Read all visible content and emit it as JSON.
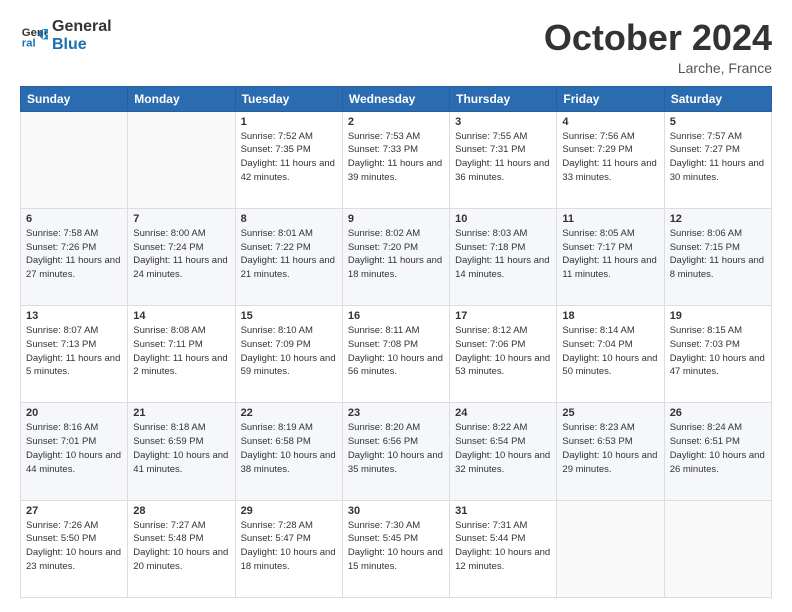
{
  "header": {
    "logo_line1": "General",
    "logo_line2": "Blue",
    "month": "October 2024",
    "location": "Larche, France"
  },
  "days_of_week": [
    "Sunday",
    "Monday",
    "Tuesday",
    "Wednesday",
    "Thursday",
    "Friday",
    "Saturday"
  ],
  "weeks": [
    [
      {
        "day": "",
        "sunrise": "",
        "sunset": "",
        "daylight": ""
      },
      {
        "day": "",
        "sunrise": "",
        "sunset": "",
        "daylight": ""
      },
      {
        "day": "1",
        "sunrise": "Sunrise: 7:52 AM",
        "sunset": "Sunset: 7:35 PM",
        "daylight": "Daylight: 11 hours and 42 minutes."
      },
      {
        "day": "2",
        "sunrise": "Sunrise: 7:53 AM",
        "sunset": "Sunset: 7:33 PM",
        "daylight": "Daylight: 11 hours and 39 minutes."
      },
      {
        "day": "3",
        "sunrise": "Sunrise: 7:55 AM",
        "sunset": "Sunset: 7:31 PM",
        "daylight": "Daylight: 11 hours and 36 minutes."
      },
      {
        "day": "4",
        "sunrise": "Sunrise: 7:56 AM",
        "sunset": "Sunset: 7:29 PM",
        "daylight": "Daylight: 11 hours and 33 minutes."
      },
      {
        "day": "5",
        "sunrise": "Sunrise: 7:57 AM",
        "sunset": "Sunset: 7:27 PM",
        "daylight": "Daylight: 11 hours and 30 minutes."
      }
    ],
    [
      {
        "day": "6",
        "sunrise": "Sunrise: 7:58 AM",
        "sunset": "Sunset: 7:26 PM",
        "daylight": "Daylight: 11 hours and 27 minutes."
      },
      {
        "day": "7",
        "sunrise": "Sunrise: 8:00 AM",
        "sunset": "Sunset: 7:24 PM",
        "daylight": "Daylight: 11 hours and 24 minutes."
      },
      {
        "day": "8",
        "sunrise": "Sunrise: 8:01 AM",
        "sunset": "Sunset: 7:22 PM",
        "daylight": "Daylight: 11 hours and 21 minutes."
      },
      {
        "day": "9",
        "sunrise": "Sunrise: 8:02 AM",
        "sunset": "Sunset: 7:20 PM",
        "daylight": "Daylight: 11 hours and 18 minutes."
      },
      {
        "day": "10",
        "sunrise": "Sunrise: 8:03 AM",
        "sunset": "Sunset: 7:18 PM",
        "daylight": "Daylight: 11 hours and 14 minutes."
      },
      {
        "day": "11",
        "sunrise": "Sunrise: 8:05 AM",
        "sunset": "Sunset: 7:17 PM",
        "daylight": "Daylight: 11 hours and 11 minutes."
      },
      {
        "day": "12",
        "sunrise": "Sunrise: 8:06 AM",
        "sunset": "Sunset: 7:15 PM",
        "daylight": "Daylight: 11 hours and 8 minutes."
      }
    ],
    [
      {
        "day": "13",
        "sunrise": "Sunrise: 8:07 AM",
        "sunset": "Sunset: 7:13 PM",
        "daylight": "Daylight: 11 hours and 5 minutes."
      },
      {
        "day": "14",
        "sunrise": "Sunrise: 8:08 AM",
        "sunset": "Sunset: 7:11 PM",
        "daylight": "Daylight: 11 hours and 2 minutes."
      },
      {
        "day": "15",
        "sunrise": "Sunrise: 8:10 AM",
        "sunset": "Sunset: 7:09 PM",
        "daylight": "Daylight: 10 hours and 59 minutes."
      },
      {
        "day": "16",
        "sunrise": "Sunrise: 8:11 AM",
        "sunset": "Sunset: 7:08 PM",
        "daylight": "Daylight: 10 hours and 56 minutes."
      },
      {
        "day": "17",
        "sunrise": "Sunrise: 8:12 AM",
        "sunset": "Sunset: 7:06 PM",
        "daylight": "Daylight: 10 hours and 53 minutes."
      },
      {
        "day": "18",
        "sunrise": "Sunrise: 8:14 AM",
        "sunset": "Sunset: 7:04 PM",
        "daylight": "Daylight: 10 hours and 50 minutes."
      },
      {
        "day": "19",
        "sunrise": "Sunrise: 8:15 AM",
        "sunset": "Sunset: 7:03 PM",
        "daylight": "Daylight: 10 hours and 47 minutes."
      }
    ],
    [
      {
        "day": "20",
        "sunrise": "Sunrise: 8:16 AM",
        "sunset": "Sunset: 7:01 PM",
        "daylight": "Daylight: 10 hours and 44 minutes."
      },
      {
        "day": "21",
        "sunrise": "Sunrise: 8:18 AM",
        "sunset": "Sunset: 6:59 PM",
        "daylight": "Daylight: 10 hours and 41 minutes."
      },
      {
        "day": "22",
        "sunrise": "Sunrise: 8:19 AM",
        "sunset": "Sunset: 6:58 PM",
        "daylight": "Daylight: 10 hours and 38 minutes."
      },
      {
        "day": "23",
        "sunrise": "Sunrise: 8:20 AM",
        "sunset": "Sunset: 6:56 PM",
        "daylight": "Daylight: 10 hours and 35 minutes."
      },
      {
        "day": "24",
        "sunrise": "Sunrise: 8:22 AM",
        "sunset": "Sunset: 6:54 PM",
        "daylight": "Daylight: 10 hours and 32 minutes."
      },
      {
        "day": "25",
        "sunrise": "Sunrise: 8:23 AM",
        "sunset": "Sunset: 6:53 PM",
        "daylight": "Daylight: 10 hours and 29 minutes."
      },
      {
        "day": "26",
        "sunrise": "Sunrise: 8:24 AM",
        "sunset": "Sunset: 6:51 PM",
        "daylight": "Daylight: 10 hours and 26 minutes."
      }
    ],
    [
      {
        "day": "27",
        "sunrise": "Sunrise: 7:26 AM",
        "sunset": "Sunset: 5:50 PM",
        "daylight": "Daylight: 10 hours and 23 minutes."
      },
      {
        "day": "28",
        "sunrise": "Sunrise: 7:27 AM",
        "sunset": "Sunset: 5:48 PM",
        "daylight": "Daylight: 10 hours and 20 minutes."
      },
      {
        "day": "29",
        "sunrise": "Sunrise: 7:28 AM",
        "sunset": "Sunset: 5:47 PM",
        "daylight": "Daylight: 10 hours and 18 minutes."
      },
      {
        "day": "30",
        "sunrise": "Sunrise: 7:30 AM",
        "sunset": "Sunset: 5:45 PM",
        "daylight": "Daylight: 10 hours and 15 minutes."
      },
      {
        "day": "31",
        "sunrise": "Sunrise: 7:31 AM",
        "sunset": "Sunset: 5:44 PM",
        "daylight": "Daylight: 10 hours and 12 minutes."
      },
      {
        "day": "",
        "sunrise": "",
        "sunset": "",
        "daylight": ""
      },
      {
        "day": "",
        "sunrise": "",
        "sunset": "",
        "daylight": ""
      }
    ]
  ]
}
